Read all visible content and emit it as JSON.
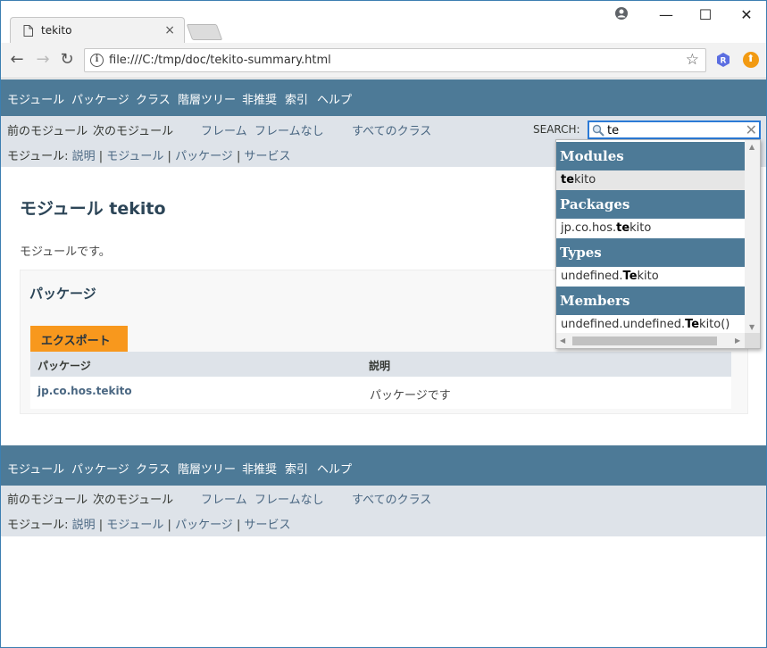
{
  "browser": {
    "tab_title": "tekito",
    "tab_close": "×",
    "url": "file:///C:/tmp/doc/tekito-summary.html",
    "info_glyph": "i",
    "star_glyph": "☆",
    "ext_r_glyph": "R",
    "ext_up_glyph": "⬆",
    "window_controls": {
      "minimize": "—",
      "maximize": "☐",
      "close": "✕"
    },
    "nav": {
      "back": "←",
      "forward": "→",
      "reload": "↻"
    }
  },
  "topnav": {
    "items": [
      "モジュール",
      "パッケージ",
      "クラス",
      "階層ツリー",
      "非推奨",
      "索引",
      "ヘルプ"
    ]
  },
  "subnav": {
    "prev_module": "前のモジュール",
    "next_module": "次のモジュール",
    "frames": "フレーム",
    "no_frames": "フレームなし",
    "all_classes": "すべてのクラス",
    "breadcrumb_prefix": "モジュール: ",
    "breadcrumb_links": [
      "説明",
      "モジュール",
      "パッケージ",
      "サービス"
    ],
    "separator": "|"
  },
  "search": {
    "label": "SEARCH:",
    "value": "te",
    "clear": "✕"
  },
  "content": {
    "title": "モジュール tekito",
    "description": "モジュールです。",
    "packages_heading": "パッケージ",
    "export_tab": "エクスポート",
    "table": {
      "headers": [
        "パッケージ",
        "説明"
      ],
      "rows": [
        {
          "package": "jp.co.hos.tekito",
          "description": "パッケージです"
        }
      ]
    }
  },
  "autocomplete": {
    "sections": [
      {
        "category": "Modules",
        "item_match": "te",
        "item_rest": "kito",
        "item_prefix": ""
      },
      {
        "category": "Packages",
        "item_prefix": "jp.co.hos.",
        "item_match": "te",
        "item_rest": "kito"
      },
      {
        "category": "Types",
        "item_prefix": "undefined.",
        "item_match": "Te",
        "item_rest": "kito"
      },
      {
        "category": "Members",
        "item_prefix": "undefined.undefined.",
        "item_match": "Te",
        "item_rest": "kito()"
      }
    ],
    "scroll": {
      "up": "▲",
      "down": "▼",
      "left": "◀",
      "right": "▶"
    }
  },
  "colors": {
    "nav_bar": "#4d7a97",
    "sub_nav": "#dee3e9",
    "export_tab": "#f8981d",
    "link": "#4a6782"
  }
}
